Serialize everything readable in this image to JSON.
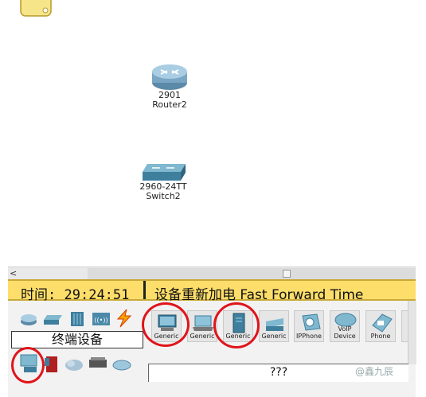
{
  "workspace": {
    "devices": [
      {
        "model": "2901",
        "name": "Router2"
      },
      {
        "model": "2960-24TT",
        "name": "Switch2"
      }
    ]
  },
  "realtime_bar": {
    "time_label": "时间:",
    "time_value": "29:24:51",
    "power_cycle": "设备重新加电",
    "fast_forward": "Fast Forward Time"
  },
  "device_panel": {
    "category_label": "终端设备",
    "tiles": [
      {
        "label": "Generic",
        "icon": "pc-icon"
      },
      {
        "label": "Generic",
        "icon": "laptop-icon"
      },
      {
        "label": "Generic",
        "icon": "server-icon"
      },
      {
        "label": "Generic",
        "icon": "printer-icon"
      },
      {
        "label": "IPPhone",
        "icon": "ip-phone-icon"
      },
      {
        "label": "VoIP\nDevice",
        "icon": "voip-device-icon"
      },
      {
        "label": "Phone",
        "icon": "phone-icon"
      }
    ],
    "selection_text": "???"
  },
  "watermark": "@鑫九辰",
  "colors": {
    "accent_bar": "#fdde6b",
    "annotation_red": "#e0141b"
  }
}
